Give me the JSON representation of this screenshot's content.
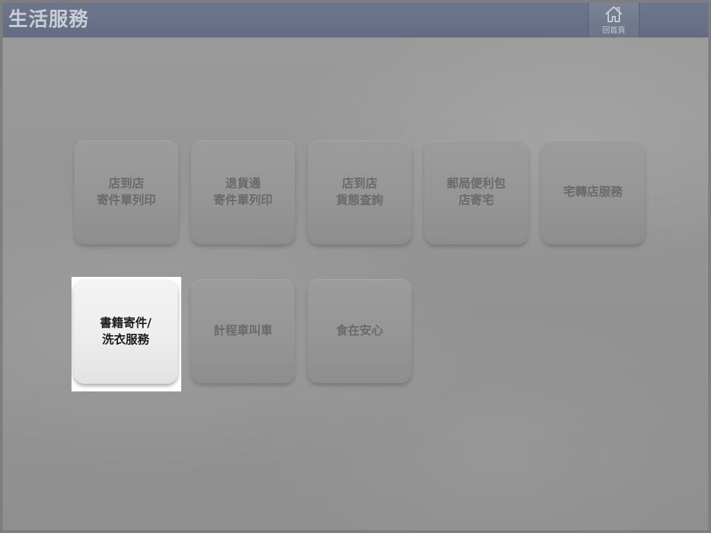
{
  "header": {
    "title": "生活服務",
    "home_label": "回首頁"
  },
  "tiles": [
    {
      "label": "店到店\n寄件單列印"
    },
    {
      "label": "退貨通\n寄件單列印"
    },
    {
      "label": "店到店\n貨態查詢"
    },
    {
      "label": "郵局便利包\n店寄宅"
    },
    {
      "label": "宅轉店服務"
    },
    {
      "label": "書籍寄件/\n洗衣服務",
      "selected": true
    },
    {
      "label": "計程車叫車"
    },
    {
      "label": "食在安心"
    }
  ],
  "colors": {
    "header_bg": "#6d768d",
    "page_bg": "#969696",
    "tile_text": "#6a6a6a",
    "selected_text": "#1e1e1e"
  }
}
